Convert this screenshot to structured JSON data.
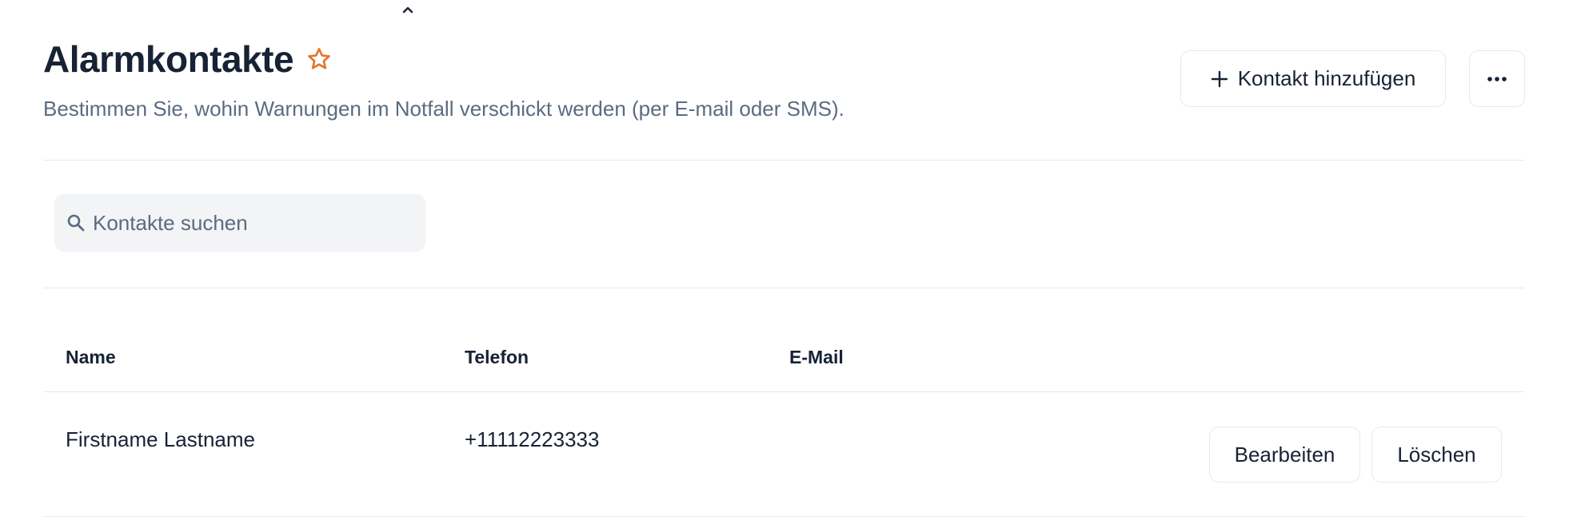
{
  "header": {
    "title": "Alarmkontakte",
    "subtitle": "Bestimmen Sie, wohin Warnungen im Notfall verschickt werden (per E-mail oder SMS).",
    "add_contact_label": "Kontakt hinzufügen"
  },
  "search": {
    "placeholder": "Kontakte suchen",
    "value": ""
  },
  "table": {
    "columns": [
      "Name",
      "Telefon",
      "E-Mail"
    ],
    "rows": [
      {
        "name": "Firstname Lastname",
        "phone": "+11112223333",
        "email": "",
        "edit_label": "Bearbeiten",
        "delete_label": "Löschen"
      }
    ]
  },
  "icons": {
    "collapse": "chevron-up-icon",
    "favorite": "star-icon",
    "add": "plus-icon",
    "more": "more-horizontal-icon",
    "search": "search-icon"
  },
  "colors": {
    "accent": "#e0782c",
    "text": "#172235",
    "muted": "#5b6b81",
    "border": "#e4e8ee",
    "search_bg": "#f3f4f6"
  }
}
